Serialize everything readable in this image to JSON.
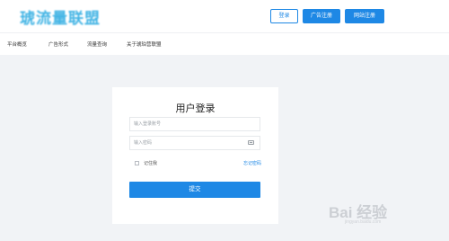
{
  "header": {
    "logo_text": "琥流量联盟",
    "buttons": {
      "login": "登录",
      "advertiser_register": "广告注册",
      "site_register": "网站注册"
    }
  },
  "nav": {
    "items": [
      "平台概览",
      "广告形式",
      "流量查询",
      "关于琥珀营联盟"
    ]
  },
  "login_card": {
    "title": "用户登录",
    "account_placeholder": "输入登录账号",
    "password_placeholder": "输入密码",
    "remember_label": "记住我",
    "forgot_link": "忘记密码",
    "submit_label": "提交"
  },
  "watermark": {
    "text": "Bai 经验",
    "sub": "jingyan.baidu.com"
  },
  "colors": {
    "accent": "#1e88e5",
    "page_bg": "#f1f3f6",
    "logo": "#24a8e0"
  },
  "icons": [
    "password-eye-icon",
    "checkbox-icon"
  ]
}
